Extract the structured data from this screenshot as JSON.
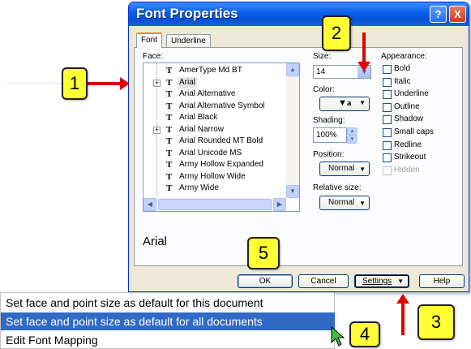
{
  "dialog": {
    "title": "Font Properties",
    "help_button": "?",
    "close_button": "X",
    "tabs": [
      {
        "label": "Font"
      },
      {
        "label": "Underline"
      }
    ],
    "face": {
      "label": "Face:",
      "fonts": [
        {
          "name": "AmerType Md BT",
          "expandable": false
        },
        {
          "name": "Arial",
          "expandable": true
        },
        {
          "name": "Arial Alternative",
          "expandable": false
        },
        {
          "name": "Arial Alternative Symbol",
          "expandable": false
        },
        {
          "name": "Arial Black",
          "expandable": false
        },
        {
          "name": "Arial Narrow",
          "expandable": true
        },
        {
          "name": "Arial Rounded MT Bold",
          "expandable": false
        },
        {
          "name": "Arial Unicode MS",
          "expandable": false
        },
        {
          "name": "Army Hollow Expanded",
          "expandable": false
        },
        {
          "name": "Army Hollow Wide",
          "expandable": false
        },
        {
          "name": "Army Wide",
          "expandable": false
        }
      ],
      "selected": "Arial"
    },
    "size": {
      "label": "Size:",
      "value": "14"
    },
    "color": {
      "label": "Color:"
    },
    "shading": {
      "label": "Shading:",
      "value": "100%"
    },
    "position": {
      "label": "Position:",
      "value": "Normal"
    },
    "relative_size": {
      "label": "Relative size:",
      "value": "Normal"
    },
    "appearance": {
      "label": "Appearance:",
      "options": [
        {
          "label": "Bold",
          "enabled": true
        },
        {
          "label": "Italic",
          "enabled": true
        },
        {
          "label": "Underline",
          "enabled": true
        },
        {
          "label": "Outline",
          "enabled": true
        },
        {
          "label": "Shadow",
          "enabled": true
        },
        {
          "label": "Small caps",
          "enabled": true
        },
        {
          "label": "Redline",
          "enabled": true
        },
        {
          "label": "Strikeout",
          "enabled": true
        },
        {
          "label": "Hidden",
          "enabled": false
        }
      ]
    },
    "preview_text": "Arial",
    "buttons": {
      "ok": "OK",
      "cancel": "Cancel",
      "settings": "Settings",
      "help": "Help"
    }
  },
  "settings_menu": {
    "items": [
      {
        "label": "Set face and point size as default for this document"
      },
      {
        "label": "Set face and point size as default for all documents"
      },
      {
        "label": "Edit Font Mapping"
      }
    ],
    "highlighted_index": 1
  },
  "callouts": [
    "1",
    "2",
    "3",
    "4",
    "5"
  ],
  "colors": {
    "titlebar": "#0550d8",
    "callout_fill": "#ffff33",
    "arrow": "#e00000",
    "menu_highlight": "#316ac5"
  }
}
